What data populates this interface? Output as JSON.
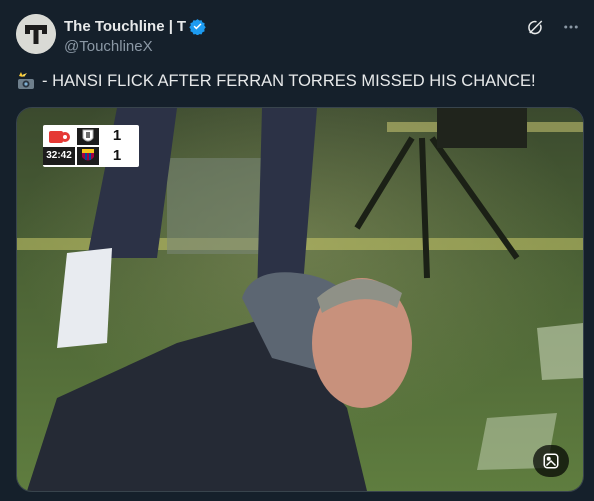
{
  "account": {
    "display_name": "The Touchline |",
    "brand_mark": "T",
    "handle": "@TouchlineX",
    "verified": true,
    "avatar_letter": "T"
  },
  "tweet": {
    "emoji": "camera-flash-emoji",
    "text": "- HANSI FLICK AFTER FERRAN TORRES MISSED HIS CHANCE!"
  },
  "scorebug": {
    "clock": "32:42",
    "home_score": "1",
    "away_score": "1"
  },
  "colors": {
    "background": "#15202b",
    "verified_blue": "#1d9bf0",
    "secondary_text": "#8b98a5"
  },
  "icons": {
    "top_right": [
      "grok-icon",
      "more-icon"
    ],
    "media": [
      "alt-text-icon"
    ]
  }
}
